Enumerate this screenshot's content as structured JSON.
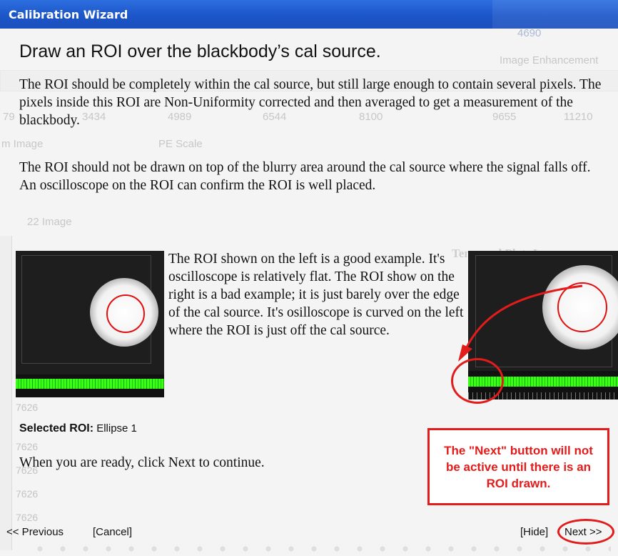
{
  "window": {
    "title": "Calibration Wizard"
  },
  "background_app": {
    "value_top": "4690",
    "panel_label": "Image Enhancement",
    "axis_ticks": [
      "79",
      "3434",
      "4989",
      "6544",
      "8100",
      "9655",
      "11210"
    ],
    "dropdowns": [
      "m Image",
      "PE Scale"
    ],
    "tab_label": "22 Image",
    "plot_title": "Temporal Plot: Image",
    "y_values": [
      "7626",
      "7626",
      "7626",
      "7626",
      "7626",
      "7626",
      "7626",
      "7626",
      "7626"
    ]
  },
  "step": {
    "heading": "Draw an ROI over the blackbody’s cal source.",
    "paragraph1": "The ROI should be completely within the cal source, but still large enough to contain several pixels.  The pixels inside this ROI are Non-Uniformity corrected and then averaged to get a measurement of the blackbody.",
    "paragraph2": "The ROI should not be drawn on top of the blurry area around the cal source where the signal falls off.  An oscilloscope on the ROI can confirm the ROI is well placed.",
    "example_text": "The ROI shown on the left is a good example.  It's oscilloscope is relatively flat.  The ROI show on the right is a bad example; it is just barely over the edge of the cal source.  It's osilloscope is curved on the left where the ROI is just off the cal source.",
    "selected_roi_label": "Selected ROI:",
    "selected_roi_value": "Ellipse 1",
    "ready_text": "When you are ready, click Next to continue."
  },
  "annotation": {
    "callout_text": "The \"Next\" button will not be active until there is an ROI drawn.",
    "color": "#e21b1b"
  },
  "footer": {
    "previous_label": "<< Previous",
    "cancel_label": "[Cancel]",
    "hide_label": "[Hide]",
    "next_label": "Next >>"
  }
}
